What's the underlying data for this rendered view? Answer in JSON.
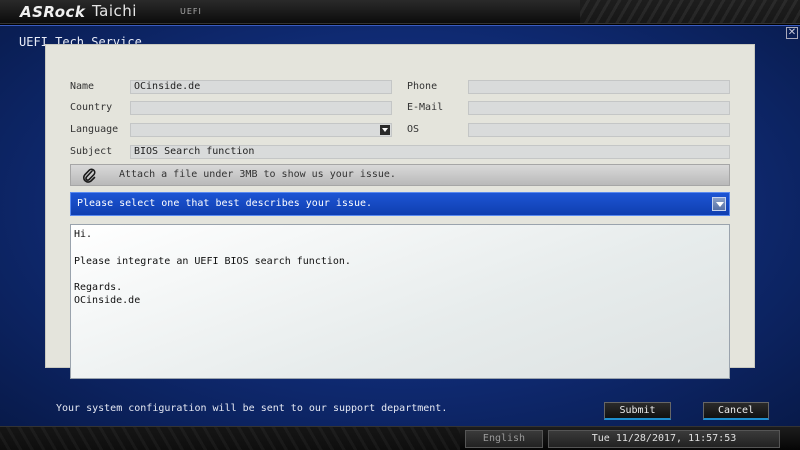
{
  "topbar": {
    "brand": "ASRock",
    "product": "Taichi",
    "mode": "UEFI"
  },
  "window": {
    "title": "UEFI Tech Service",
    "close_icon": "close-icon"
  },
  "form": {
    "name_label": "Name",
    "name_value": "OCinside.de",
    "country_label": "Country",
    "country_value": "",
    "language_label": "Language",
    "language_value": "",
    "subject_label": "Subject",
    "subject_value": "BIOS Search function",
    "phone_label": "Phone",
    "phone_value": "",
    "email_label": "E-Mail",
    "email_value": "",
    "os_label": "OS",
    "os_value": "",
    "attach_icon": "paperclip-icon",
    "attach_text": "Attach a file under 3MB to show us your issue.",
    "issue_select_text": "Please select one that best describes your issue.",
    "message_lines": [
      "Hi.",
      "",
      "Please integrate an UEFI BIOS search function.",
      "",
      "Regards.",
      "OCinside.de"
    ]
  },
  "footer": {
    "note": "Your system configuration will be sent to our support department.",
    "submit_label": "Submit",
    "cancel_label": "Cancel"
  },
  "statusbar": {
    "language": "English",
    "datetime": "Tue 11/28/2017, 11:57:53"
  },
  "colors": {
    "accent_blue": "#0f3eb0",
    "window_blue": "#0f2a72",
    "panel": "#e4e4dc",
    "button_underline": "#1e8fcf"
  }
}
